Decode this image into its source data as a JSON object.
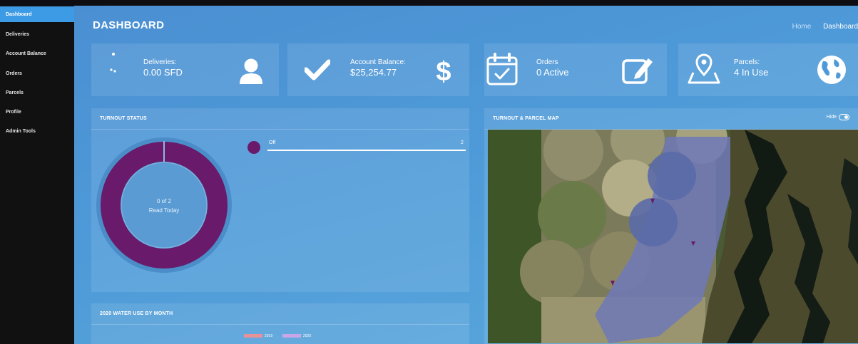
{
  "sidebar": {
    "items": [
      {
        "label": "Dashboard",
        "active": true
      },
      {
        "label": "Deliveries",
        "active": false
      },
      {
        "label": "Account Balance",
        "active": false
      },
      {
        "label": "Orders",
        "active": false
      },
      {
        "label": "Parcels",
        "active": false
      },
      {
        "label": "Profile",
        "active": false
      },
      {
        "label": "Admin Tools",
        "active": false
      }
    ]
  },
  "header": {
    "title": "DASHBOARD",
    "breadcrumb": {
      "home": "Home",
      "current": "Dashboard"
    }
  },
  "stats": {
    "deliveries": {
      "label": "Deliveries:",
      "value": "0.00 SFD",
      "icon": "person-icon"
    },
    "account_balance": {
      "label": "Account Balance:",
      "value": "$25,254.77",
      "icon": "dollar-icon"
    },
    "orders": {
      "label": "Orders",
      "value": "0 Active",
      "icon": "edit-icon"
    },
    "parcels": {
      "label": "Parcels:",
      "value": "4 In Use",
      "icon": "globe-icon"
    }
  },
  "turnout_status": {
    "title": "TURNOUT STATUS",
    "donut": {
      "line1": "0 of 2",
      "line2": "Read Today",
      "total": 2,
      "read": 0,
      "color": "#6a1a6a"
    },
    "legend": [
      {
        "label": "Off",
        "count": "2",
        "color": "#6a1a6a"
      }
    ]
  },
  "map_panel": {
    "title": "TURNOUT & PARCEL MAP",
    "toggle_label": "Hide"
  },
  "water_use": {
    "title": "2020 WATER USE BY MONTH",
    "legend": [
      {
        "label": "2019",
        "color": "#e8919a"
      },
      {
        "label": "2020",
        "color": "#c9a6e8"
      }
    ]
  },
  "colors": {
    "sidebar_bg": "#111111",
    "sidebar_active": "#3d9be6",
    "main_bg": "#4e9ad8",
    "accent_purple": "#6a1a6a"
  }
}
